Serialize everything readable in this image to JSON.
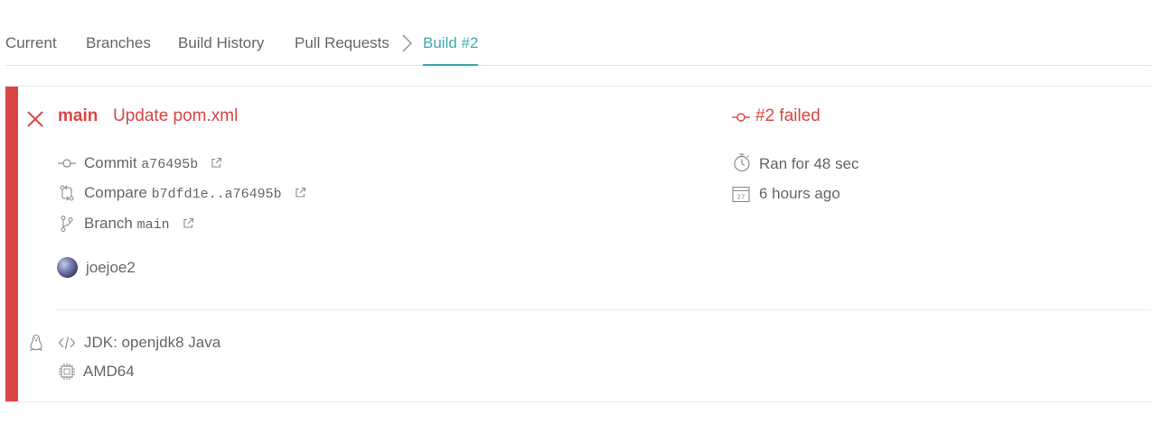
{
  "tabs": [
    {
      "label": "Current"
    },
    {
      "label": "Branches"
    },
    {
      "label": "Build History"
    },
    {
      "label": "Pull Requests"
    },
    {
      "label": "Build #2",
      "active": true
    }
  ],
  "colors": {
    "failed": "#db4545",
    "accent": "#3eaaaf",
    "text": "#666666"
  },
  "build": {
    "state_icon": "close-icon",
    "branch": "main",
    "message": "Update pom.xml",
    "status_label": "#2 failed",
    "commit_label": "Commit",
    "commit_sha": "a76495b",
    "compare_label": "Compare",
    "compare_range": "b7dfd1e..a76495b",
    "branch_label": "Branch",
    "branch_value": "main",
    "author": "joejoe2",
    "duration": "Ran for 48 sec",
    "finished": "6 hours ago",
    "calendar_day": "27"
  },
  "environment": {
    "os_icon": "linux-tux-icon",
    "jdk": "JDK: openjdk8 Java",
    "arch": "AMD64"
  }
}
